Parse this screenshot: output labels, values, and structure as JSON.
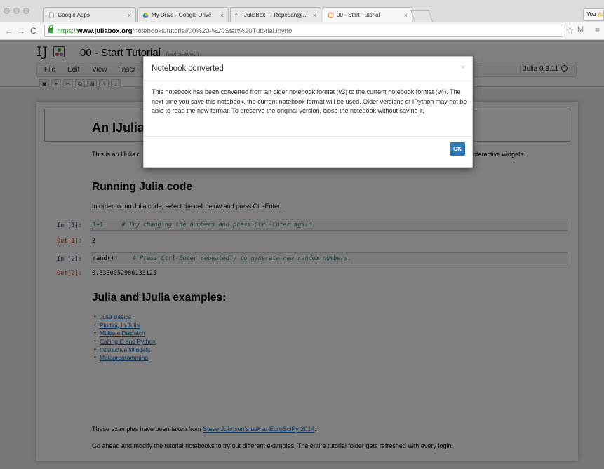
{
  "browser": {
    "tabs": [
      {
        "title": "Google Apps",
        "active": false
      },
      {
        "title": "My Drive - Google Drive",
        "active": false
      },
      {
        "title": "JuliaBox — lzepedan@uci.e",
        "active": false
      },
      {
        "title": "00 - Start Tutorial",
        "active": true
      }
    ],
    "profile": "You",
    "url_scheme": "https://",
    "url_host": "www.juliabox.org",
    "url_path": "/notebooks/tutorial/00%20-%20Start%20Tutorial.ipynb"
  },
  "notebook": {
    "logo": "IJ",
    "title": "00 - Start Tutorial",
    "autosave_status": "(autosaved)",
    "menu": [
      "File",
      "Edit",
      "View",
      "Inser"
    ],
    "kernel": "Julia 0.3.11",
    "toolbar_icons": [
      "save-icon",
      "add-cell-icon",
      "cut-icon",
      "copy-icon",
      "paste-icon",
      "move-up-icon",
      "move-down-icon"
    ],
    "heading1": "An IJulia",
    "intro": "This is an IJulia r",
    "intro_tail": "nteractive widgets.",
    "heading2": "Running Julia code",
    "run_instruction": "In order to run Julia code, select the cell below and press Ctrl-Enter.",
    "cells": [
      {
        "in_prompt": "In [1]:",
        "code": "1+1",
        "comment": "# Try changing the numbers and press Ctrl-Enter again.",
        "out_prompt": "Out[1]:",
        "output": "2"
      },
      {
        "in_prompt": "In [2]:",
        "code": "rand()",
        "comment": "# Press Ctrl-Enter repeatedly to generate new random numbers.",
        "out_prompt": "Out[2]:",
        "output": "0.8330052986133125"
      }
    ],
    "examples_heading": "Julia and IJulia examples:",
    "examples": [
      "Julia Basics",
      "Plotting in Julia",
      "Multiple Dispatch",
      "Calling C and Python",
      "Interactive Widgets",
      "Metaprogramming"
    ],
    "credit_prefix": "These examples have been taken from ",
    "credit_link": "Steve Johnson's talk at EuroSciPy 2014",
    "credit_suffix": ".",
    "footer_text": "Go ahead and modify the tutorial notebooks to try out different examples. The entire tutorial folder gets refreshed with every login."
  },
  "modal": {
    "title": "Notebook converted",
    "close_glyph": "×",
    "body": "This notebook has been converted from an older notebook format (v3) to the current notebook format (v4). The next time you save this notebook, the current notebook format will be used. Older versions of IPython may not be able to read the new format. To preserve the original version, close the notebook without saving it.",
    "ok_label": "OK"
  }
}
